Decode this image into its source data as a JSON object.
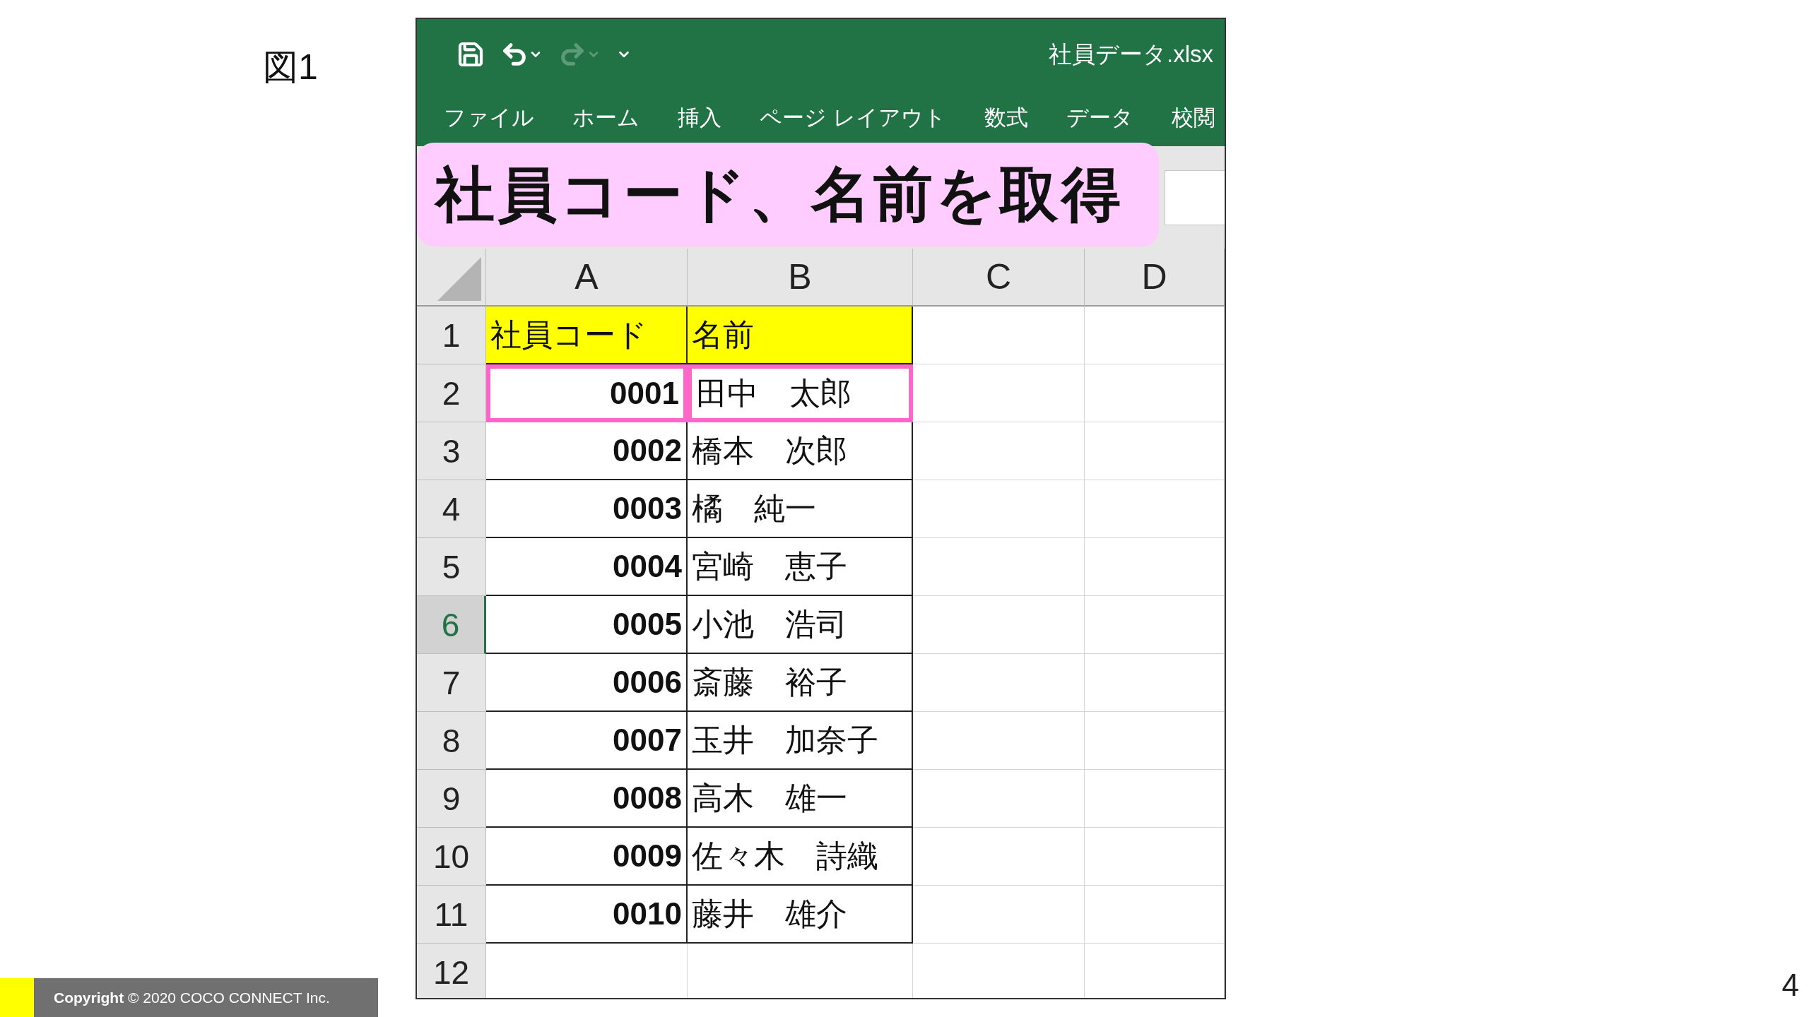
{
  "figure_label": "図1",
  "window": {
    "quick_access": [
      {
        "kind": "save",
        "disabled": false
      },
      {
        "kind": "undo",
        "disabled": false
      },
      {
        "kind": "redo",
        "disabled": true
      },
      {
        "kind": "customize",
        "disabled": false
      }
    ],
    "title": "社員データ.xlsx",
    "tabs": [
      "ファイル",
      "ホーム",
      "挿入",
      "ページ レイアウト",
      "数式",
      "データ",
      "校閲"
    ]
  },
  "banner": "社員コード、名前を取得",
  "sheet": {
    "columns": [
      "A",
      "B",
      "C",
      "D"
    ],
    "rows": [
      {
        "number": "1",
        "kind": "header",
        "highlighted": false,
        "active": false,
        "cells": [
          "社員コード",
          "名前"
        ]
      },
      {
        "number": "2",
        "kind": "data",
        "highlighted": true,
        "active": false,
        "cells": [
          "0001",
          "田中　太郎"
        ]
      },
      {
        "number": "3",
        "kind": "data",
        "highlighted": false,
        "active": false,
        "cells": [
          "0002",
          "橋本　次郎"
        ]
      },
      {
        "number": "4",
        "kind": "data",
        "highlighted": false,
        "active": false,
        "cells": [
          "0003",
          "橘　純一"
        ]
      },
      {
        "number": "5",
        "kind": "data",
        "highlighted": false,
        "active": false,
        "cells": [
          "0004",
          "宮崎　恵子"
        ]
      },
      {
        "number": "6",
        "kind": "data",
        "highlighted": false,
        "active": true,
        "cells": [
          "0005",
          "小池　浩司"
        ]
      },
      {
        "number": "7",
        "kind": "data",
        "highlighted": false,
        "active": false,
        "cells": [
          "0006",
          "斎藤　裕子"
        ]
      },
      {
        "number": "8",
        "kind": "data",
        "highlighted": false,
        "active": false,
        "cells": [
          "0007",
          "玉井　加奈子"
        ]
      },
      {
        "number": "9",
        "kind": "data",
        "highlighted": false,
        "active": false,
        "cells": [
          "0008",
          "高木　雄一"
        ]
      },
      {
        "number": "10",
        "kind": "data",
        "highlighted": false,
        "active": false,
        "cells": [
          "0009",
          "佐々木　詩織"
        ]
      },
      {
        "number": "11",
        "kind": "data",
        "highlighted": false,
        "active": false,
        "cells": [
          "0010",
          "藤井　雄介"
        ]
      },
      {
        "number": "12",
        "kind": "empty",
        "active": false
      }
    ]
  },
  "footer": {
    "copyright_label": "Copyright",
    "copyright_text": "© 2020 COCO CONNECT Inc."
  },
  "page_number": "4"
}
